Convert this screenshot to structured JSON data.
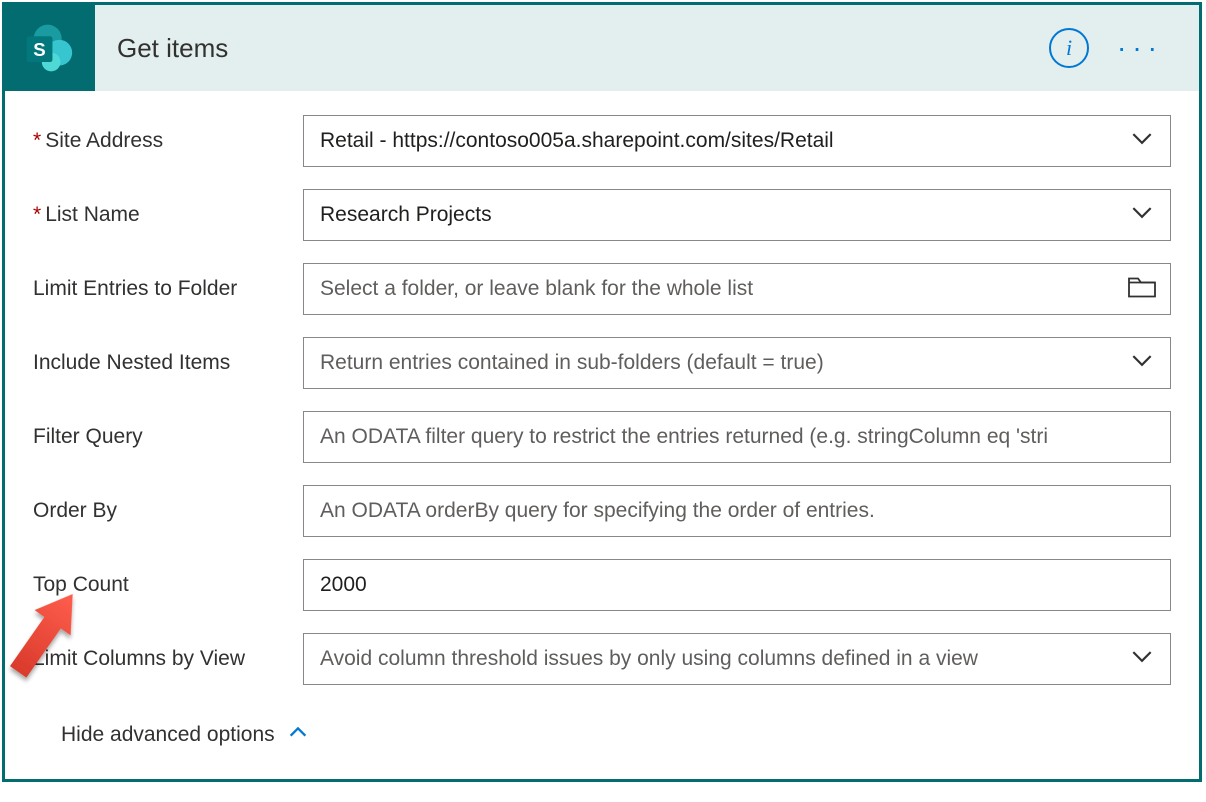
{
  "connector": "SharePoint",
  "action_title": "Get items",
  "fields": {
    "site_address": {
      "label": "Site Address",
      "required": true,
      "value": "Retail - https://contoso005a.sharepoint.com/sites/Retail"
    },
    "list_name": {
      "label": "List Name",
      "required": true,
      "value": "Research Projects"
    },
    "limit_folder": {
      "label": "Limit Entries to Folder",
      "placeholder": "Select a folder, or leave blank for the whole list"
    },
    "nested": {
      "label": "Include Nested Items",
      "placeholder": "Return entries contained in sub-folders (default = true)"
    },
    "filter": {
      "label": "Filter Query",
      "placeholder": "An ODATA filter query to restrict the entries returned (e.g. stringColumn eq 'stri"
    },
    "orderby": {
      "label": "Order By",
      "placeholder": "An ODATA orderBy query for specifying the order of entries."
    },
    "top": {
      "label": "Top Count",
      "value": "2000"
    },
    "limit_cols": {
      "label": "Limit Columns by View",
      "placeholder": "Avoid column threshold issues by only using columns defined in a view"
    }
  },
  "toggle_label": "Hide advanced options"
}
